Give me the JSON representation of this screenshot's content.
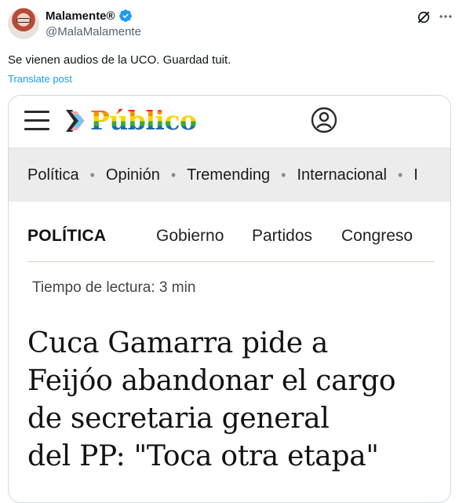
{
  "tweet": {
    "author_name": "Malamente®",
    "handle": "@MalaMalamente",
    "text": "Se vienen audios de la UCO. Guardad tuit.",
    "translate_label": "Translate post",
    "icons": [
      "verified-badge-icon",
      "grok-icon",
      "more-options-icon"
    ],
    "accent_color": "#1d9bf0"
  },
  "card": {
    "site_logo": "Público",
    "nav_items": [
      "Política",
      "Opinión",
      "Tremending",
      "Internacional",
      "I"
    ],
    "section": {
      "title": "POLÍTICA",
      "links": [
        "Gobierno",
        "Partidos",
        "Congreso"
      ]
    },
    "reading_time": "Tiempo de lectura: 3 min",
    "headline_lines": [
      "Cuca Gamarra pide a",
      "Feijóo abandonar el cargo",
      "de secretaria general",
      "del PP: \"Toca otra etapa\""
    ]
  }
}
